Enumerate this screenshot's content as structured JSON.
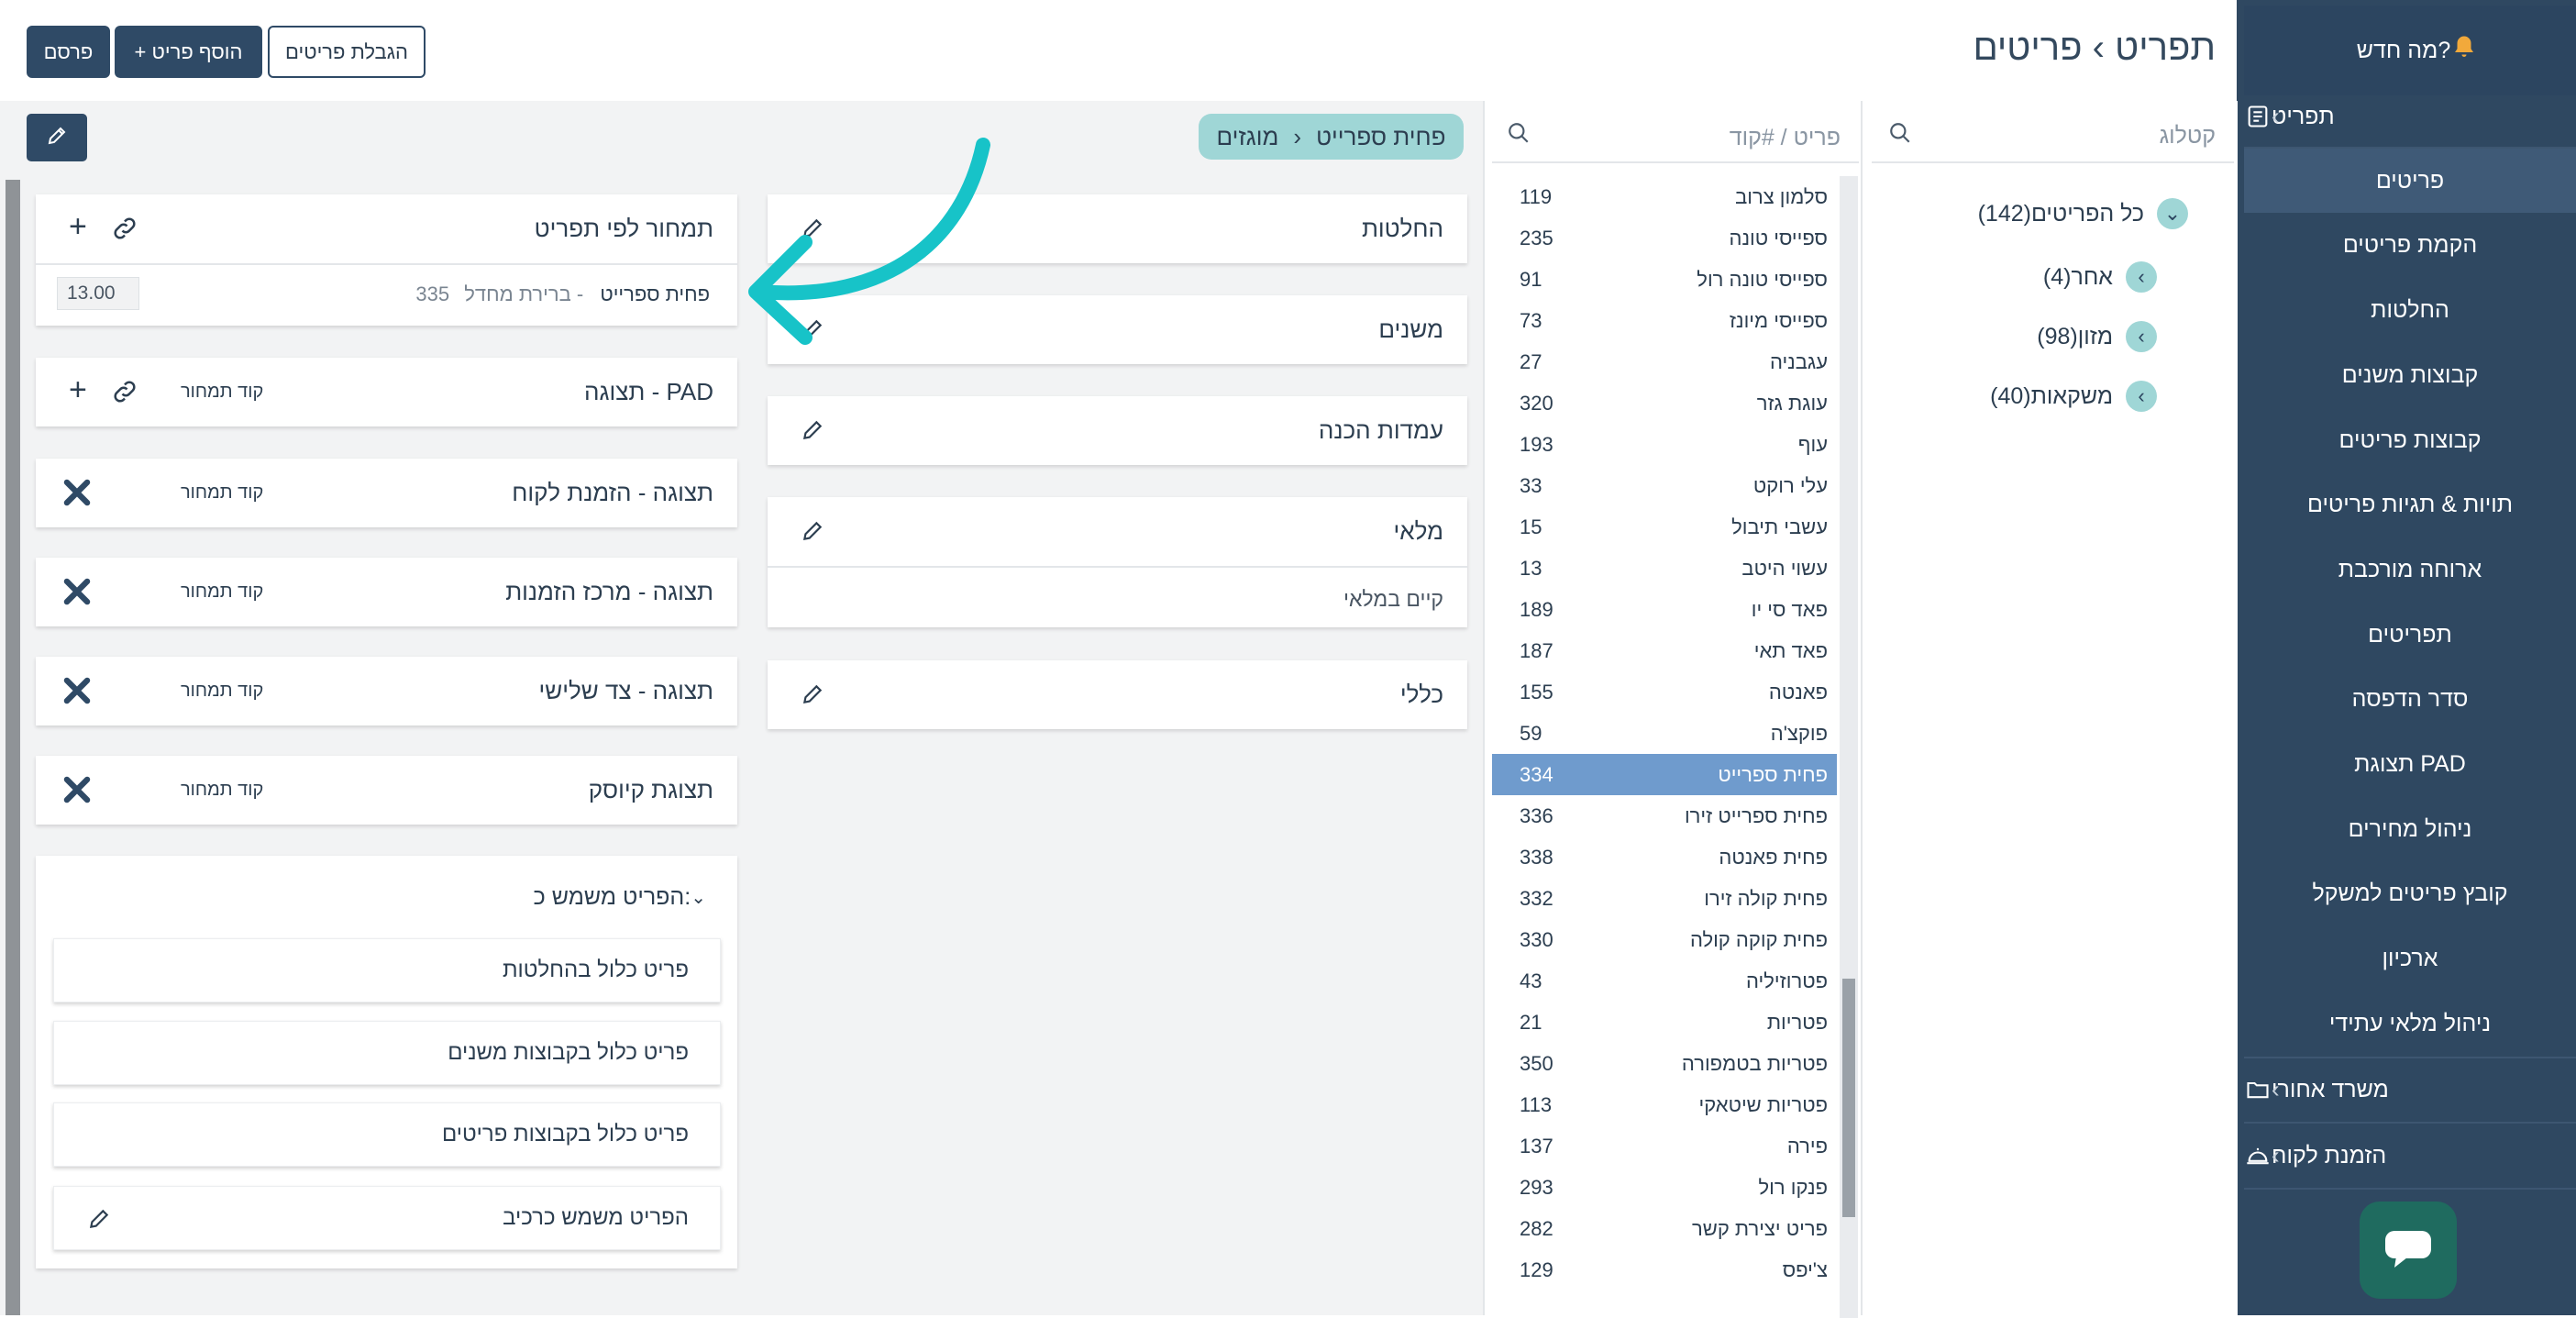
{
  "sidebar": {
    "whats_new": "מה חדש?",
    "menu_section": "תפריט",
    "items": [
      {
        "label": "פריטים",
        "active": true
      },
      {
        "label": "הקמת פריטים"
      },
      {
        "label": "החלטות"
      },
      {
        "label": "קבוצות משנים"
      },
      {
        "label": "קבוצות פריטים"
      },
      {
        "label": "תויות & תגיות פריטים"
      },
      {
        "label": "ארוחה מורכבת"
      },
      {
        "label": "תפריטים"
      },
      {
        "label": "סדר הדפסה"
      },
      {
        "label": "תצוגת PAD"
      },
      {
        "label": "ניהול מחירים"
      },
      {
        "label": "קובץ פריטים למשקל"
      },
      {
        "label": "ארכיון"
      },
      {
        "label": "ניהול מלאי עתידי"
      }
    ],
    "back_office": "משרד אחורי",
    "customer_order": "הזמנת לקוח"
  },
  "header": {
    "title": "תפריט › פריטים",
    "items_limit": "הגבלת פריטים",
    "add_item": "+ הוסף פריט",
    "publish": "פרסם"
  },
  "catalog": {
    "placeholder": "קטלוג",
    "all_items": "כל הפריטים(142)",
    "categories": [
      "אחר(4)",
      "מזון(98)",
      "משקאות(40)"
    ]
  },
  "items": {
    "placeholder": "פריט / #קוד",
    "list": [
      {
        "name": "סלמון צרוב",
        "code": "119"
      },
      {
        "name": "ספייסי טונה",
        "code": "235"
      },
      {
        "name": "ספייסי טונה רול",
        "code": "91"
      },
      {
        "name": "ספייסי מיונז",
        "code": "73"
      },
      {
        "name": "עגבניה",
        "code": "27"
      },
      {
        "name": "עוגת גזר",
        "code": "320"
      },
      {
        "name": "עוף",
        "code": "193"
      },
      {
        "name": "עלי רוקט",
        "code": "33"
      },
      {
        "name": "עשבי תיבול",
        "code": "15"
      },
      {
        "name": "עשוי היטב",
        "code": "13"
      },
      {
        "name": "פאד סי יו",
        "code": "189"
      },
      {
        "name": "פאד תאי",
        "code": "187"
      },
      {
        "name": "פאנטה",
        "code": "155"
      },
      {
        "name": "פוקצ'ה",
        "code": "59"
      },
      {
        "name": "פחית ספרייט",
        "code": "334",
        "selected": true
      },
      {
        "name": "פחית ספרייט זירו",
        "code": "336"
      },
      {
        "name": "פחית פאנטה",
        "code": "338"
      },
      {
        "name": "פחית קולה זירו",
        "code": "332"
      },
      {
        "name": "פחית קוקה קולה",
        "code": "330"
      },
      {
        "name": "פטרוזיליה",
        "code": "43"
      },
      {
        "name": "פטריות",
        "code": "21"
      },
      {
        "name": "פטריות בטמפורה",
        "code": "350"
      },
      {
        "name": "פטריות שיטאקי",
        "code": "113"
      },
      {
        "name": "פירה",
        "code": "137"
      },
      {
        "name": "פנקו רול",
        "code": "293"
      },
      {
        "name": "פריט יצירת קשר",
        "code": "282"
      },
      {
        "name": "צ'יפס",
        "code": "129"
      }
    ]
  },
  "breadcrumb": {
    "category": "מוגזים",
    "sep": "›",
    "item": "פחית ספרייט"
  },
  "middle_cards": {
    "decisions": "החלטות",
    "modifiers": "משנים",
    "prep_stations": "עמדות הכנה",
    "inventory": "מלאי",
    "inventory_value": "קיים במלאי",
    "general": "כללי"
  },
  "pricing": {
    "title": "תמחור לפי תפריט",
    "item_name": "פחית ספרייט",
    "separator": "- ",
    "default": "ברירת מחדל",
    "code": "335",
    "price": "13.00"
  },
  "displays": {
    "code_label": "קוד תמחור",
    "pad": "תצוגה - PAD",
    "customer_order": "תצוגה - הזמנת לקוח",
    "order_center": "תצוגה - מרכז הזמנות",
    "third_party": "תצוגה - צד שלישי",
    "kiosk": "תצוגת קיוסק"
  },
  "usage": {
    "title": "הפריט משמש כ:",
    "rows": [
      "פריט כלול בהחלטות",
      "פריט כלול בקבוצות משנים",
      "פריט כלול בקבוצות פריטים",
      "הפריט משמש כרכיב"
    ]
  },
  "colors": {
    "sidebar": "#2f4861",
    "accent_teal": "#9fd6d6",
    "selected_row": "#6f9bcd",
    "arrow": "#17c3c8"
  }
}
